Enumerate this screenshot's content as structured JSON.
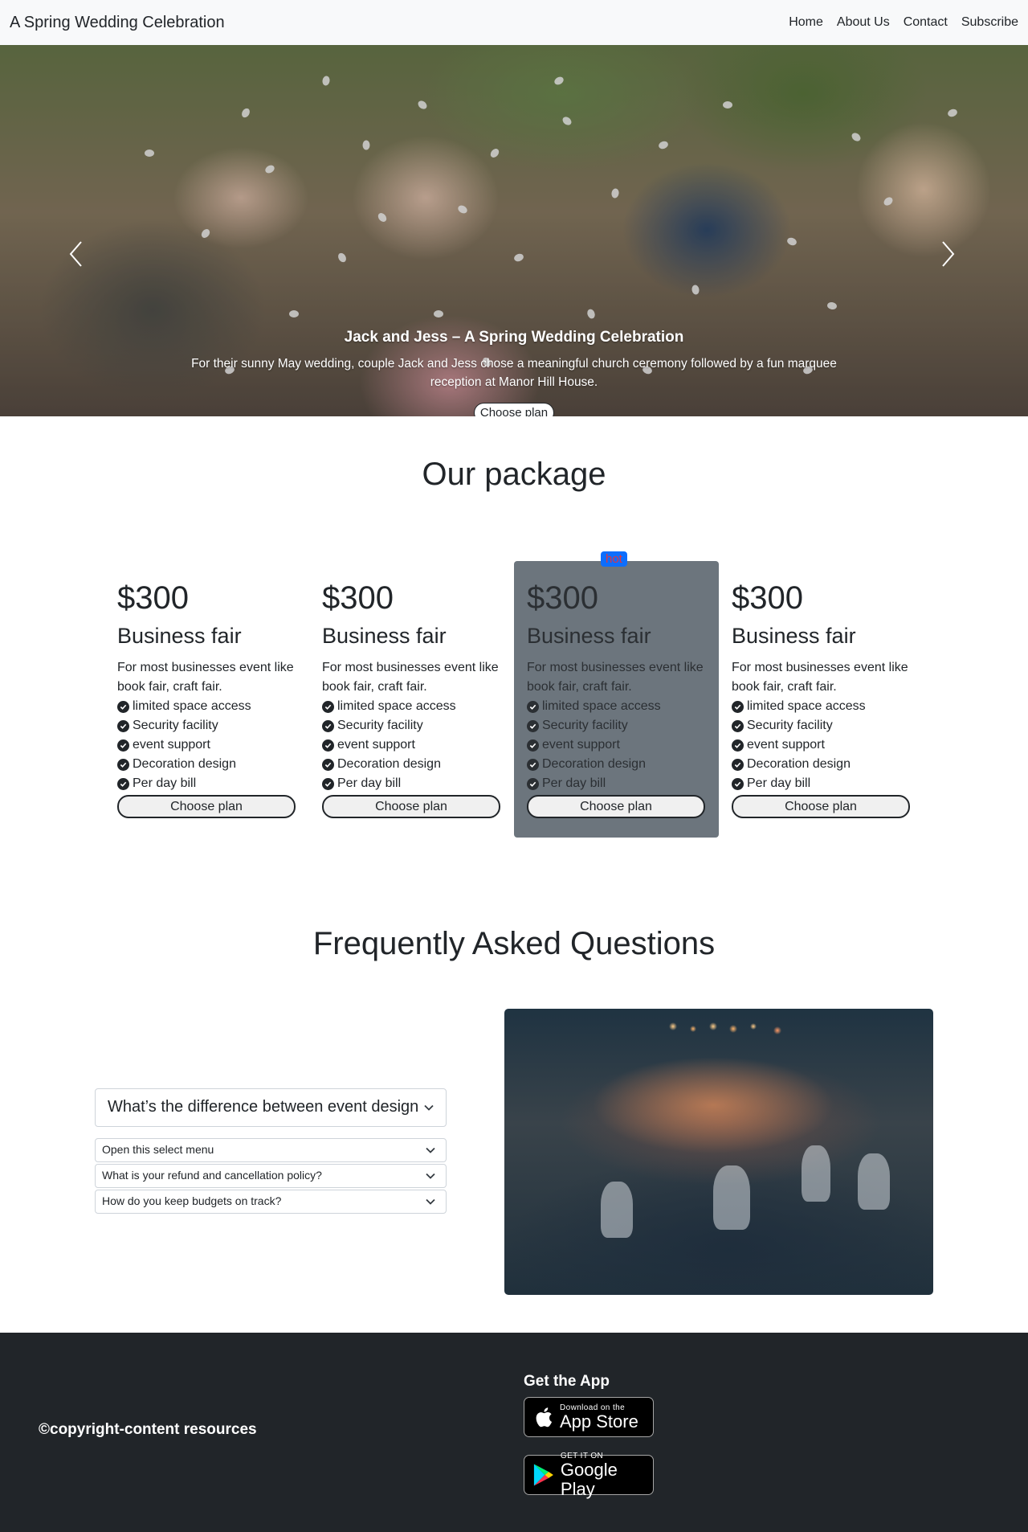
{
  "navbar": {
    "brand": "A Spring Wedding Celebration",
    "links": [
      "Home",
      "About Us",
      "Contact",
      "Subscribe"
    ]
  },
  "hero": {
    "title": "Jack and Jess – A Spring Wedding Celebration",
    "text": "For their sunny May wedding, couple Jack and Jess chose a meaningful church ceremony followed by a fun marquee reception at Manor Hill House.",
    "button": "Choose plan",
    "indicator_count": 4,
    "active_indicator": 3
  },
  "package": {
    "title": "Our package",
    "cards": [
      {
        "price": "$300",
        "name": "Business fair",
        "desc": "For most businesses event like book fair, craft fair.",
        "features": [
          "limited space access",
          "Security facility",
          "event support",
          "Decoration design",
          "Per day bill"
        ],
        "button": "Choose plan"
      },
      {
        "price": "$300",
        "name": "Business fair",
        "desc": "For most businesses event like book fair, craft fair.",
        "features": [
          "limited space access",
          "Security facility",
          "event support",
          "Decoration design",
          "Per day bill"
        ],
        "button": "Choose plan"
      },
      {
        "price": "$300",
        "name": "Business fair",
        "desc": "For most businesses event like book fair, craft fair.",
        "features": [
          "limited space access",
          "Security facility",
          "event support",
          "Decoration design",
          "Per day bill"
        ],
        "button": "Choose plan",
        "badge": "hot"
      },
      {
        "price": "$300",
        "name": "Business fair",
        "desc": "For most businesses event like book fair, craft fair.",
        "features": [
          "limited space access",
          "Security facility",
          "event support",
          "Decoration design",
          "Per day bill"
        ],
        "button": "Choose plan"
      }
    ]
  },
  "faq": {
    "title": "Frequently Asked Questions",
    "main_select": "What’s the difference between event design",
    "selects": [
      "Open this select menu",
      "What is your refund and cancellation policy?",
      "How do you keep budgets on track?"
    ]
  },
  "footer": {
    "copyright": "©copyright-content resources",
    "app_title": "Get the App",
    "apple_small": "Download on the",
    "apple_big": "App Store",
    "google_small": "GET IT ON",
    "google_big": "Google Play"
  },
  "colors": {
    "navbar_bg": "#f8f9fa",
    "hot_card_bg": "#6c757d",
    "badge_bg": "#0d6efd",
    "badge_text": "#dc3545",
    "footer_bg": "#212529"
  }
}
